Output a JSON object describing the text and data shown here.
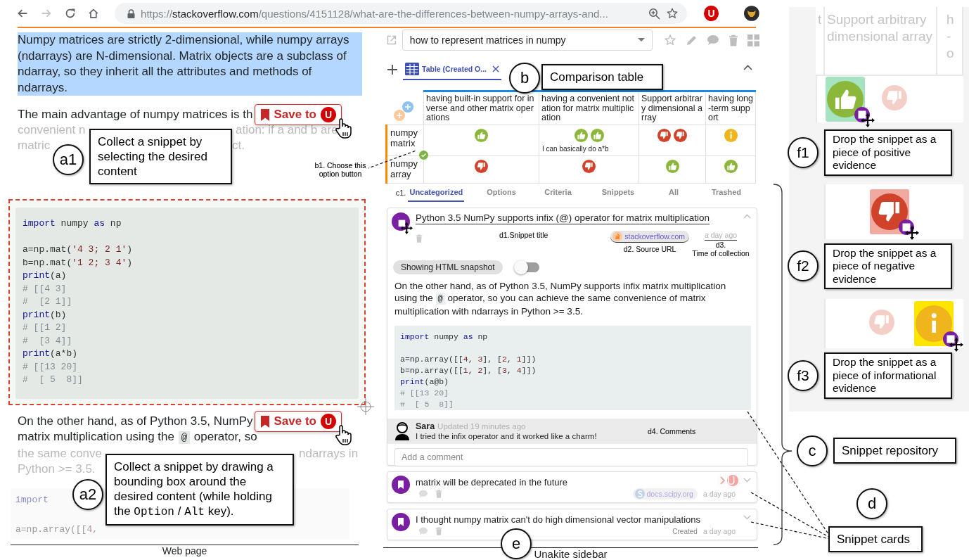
{
  "browser": {
    "url": {
      "scheme": "https://",
      "host": "stackoverflow.com",
      "path": "/questions/4151128/what-are-the-differences-between-numpy-arrays-and..."
    },
    "extension_badge": "U"
  },
  "web_page": {
    "selected_paragraph": "Numpy matrices are strictly 2-dimensional, while numpy arrays (ndarrays) are N-dimensional. Matrix objects are a subclass of ndarray, so they inherit all the attributes and methods of ndarrays.",
    "paragraph_start": "The main advantage of numpy matrices is th",
    "faded_lines": [
      {
        "left": "convenient n",
        "right": "ation: if a and b are"
      },
      {
        "left": "matric",
        "right": "ct."
      }
    ],
    "save_buttons": [
      {
        "label": "Save to",
        "badge": "U"
      },
      {
        "label": "Save to",
        "badge": "U"
      }
    ],
    "code_lines": [
      {
        "tokens": [
          {
            "text": "import",
            "kind": "keyword"
          },
          {
            "text": " numpy ",
            "kind": "plain"
          },
          {
            "text": "as",
            "kind": "keyword"
          },
          {
            "text": " np",
            "kind": "plain"
          }
        ]
      },
      {
        "gap_before": true,
        "tokens": [
          {
            "text": "a=np.mat(",
            "kind": "plain"
          },
          {
            "text": "'4 3; 2 1'",
            "kind": "string"
          },
          {
            "text": ")",
            "kind": "plain"
          }
        ]
      },
      {
        "tokens": [
          {
            "text": "b=np.mat(",
            "kind": "plain"
          },
          {
            "text": "'1 2; 3 4'",
            "kind": "string"
          },
          {
            "text": ")",
            "kind": "plain"
          }
        ]
      },
      {
        "tokens": [
          {
            "text": "print",
            "kind": "keyword"
          },
          {
            "text": "(a)",
            "kind": "plain"
          }
        ]
      },
      {
        "tokens": [
          {
            "text": "# [[4 3]",
            "kind": "comment"
          }
        ]
      },
      {
        "tokens": [
          {
            "text": "#  [2 1]]",
            "kind": "comment"
          }
        ]
      },
      {
        "tokens": [
          {
            "text": "print",
            "kind": "keyword"
          },
          {
            "text": "(b)",
            "kind": "plain"
          }
        ]
      },
      {
        "tokens": [
          {
            "text": "# [[1 2]",
            "kind": "comment"
          }
        ]
      },
      {
        "tokens": [
          {
            "text": "#  [3 4]]",
            "kind": "comment"
          }
        ]
      },
      {
        "tokens": [
          {
            "text": "print",
            "kind": "keyword"
          },
          {
            "text": "(a*b)",
            "kind": "plain"
          }
        ]
      },
      {
        "tokens": [
          {
            "text": "# [[13 20]",
            "kind": "comment"
          }
        ]
      },
      {
        "tokens": [
          {
            "text": "#  [ 5  8]]",
            "kind": "comment"
          }
        ]
      }
    ],
    "answer_line_1": "On the other hand, as of Python 3.5, NumPy",
    "answer_line_2": {
      "before": "matrix multiplication using the ",
      "code": "@",
      "after": " operator, so"
    },
    "faded_answer_lines": [
      {
        "left": "the same conve",
        "right": "ndarrays in"
      },
      {
        "left": "Python >= 3.5."
      }
    ],
    "faded_code_lines": [
      {
        "tokens": [
          {
            "text": "import",
            "kind": "keyword"
          }
        ]
      },
      {
        "gap_before": true,
        "tokens": [
          {
            "text": "a=np.array([[",
            "kind": "plain"
          },
          {
            "text": "4",
            "kind": "number"
          },
          {
            "text": ",",
            "kind": "plain"
          }
        ]
      }
    ]
  },
  "sidebar": {
    "task": "how to represent matrices in numpy",
    "table_tab": {
      "label": "Table (Created O...",
      "selected": true
    },
    "table": {
      "columns": [
        "having built-in support for inverse and other matrix operations",
        "having a convenient notation for matrix multiplication",
        "Support arbitrary dimensional array",
        "having long-term support"
      ],
      "rows": [
        {
          "label": "numpy matrix",
          "selected": true,
          "cells": [
            {
              "evidence": [
                {
                  "kind": "positive"
                }
              ]
            },
            {
              "evidence": [
                {
                  "kind": "positive"
                },
                {
                  "kind": "positive"
                }
              ],
              "note": "I can basically do a*b"
            },
            {
              "evidence": [
                {
                  "kind": "negative"
                },
                {
                  "kind": "negative"
                }
              ]
            },
            {
              "evidence": [
                {
                  "kind": "info"
                }
              ]
            }
          ]
        },
        {
          "label": "numpy array",
          "selected": false,
          "cells": [
            {
              "evidence": [
                {
                  "kind": "negative"
                }
              ]
            },
            {
              "evidence": [
                {
                  "kind": "negative"
                }
              ]
            },
            {
              "evidence": [
                {
                  "kind": "positive"
                }
              ]
            },
            {
              "evidence": [
                {
                  "kind": "positive"
                }
              ]
            }
          ]
        }
      ]
    },
    "tab_annotation": "c1.",
    "tabs": [
      {
        "label": "Uncategorized",
        "selected": true
      },
      {
        "label": "Options",
        "selected": false
      },
      {
        "label": "Criteria",
        "selected": false
      },
      {
        "label": "Snippets",
        "selected": false
      },
      {
        "label": "All",
        "selected": false
      },
      {
        "label": "Trashed",
        "selected": false
      }
    ],
    "snippets": [
      {
        "title": "Python 3.5 NumPy supports infix (@) operator for matrix multiplication",
        "expanded": true,
        "title_note": "d1.Snippet title",
        "source": {
          "kind": "stackoverflow",
          "host": "stackoverflow.com",
          "note": "d2. Source URL"
        },
        "time": "a day ago",
        "time_note": [
          "d3.",
          "Time of collection"
        ],
        "snapshot": {
          "label": "Showing HTML snapshot",
          "on": false
        },
        "body": {
          "before": "On the other hand, as of Python 3.5, NumPy supports infix matrix multiplication using the ",
          "code": "@",
          "after": " operator, so you can achieve the same convenience of matrix multiplication with ndarrays in Python >= 3.5."
        },
        "code_lines": [
          {
            "tokens": [
              {
                "text": "import",
                "kind": "keyword"
              },
              {
                "text": " numpy ",
                "kind": "plain"
              },
              {
                "text": "as",
                "kind": "keyword"
              },
              {
                "text": " np",
                "kind": "plain"
              }
            ]
          },
          {
            "gap_before": true,
            "tokens": [
              {
                "text": "a=np.array([[",
                "kind": "plain"
              },
              {
                "text": "4",
                "kind": "number"
              },
              {
                "text": ", ",
                "kind": "plain"
              },
              {
                "text": "3",
                "kind": "number"
              },
              {
                "text": "], [",
                "kind": "plain"
              },
              {
                "text": "2",
                "kind": "number"
              },
              {
                "text": ", ",
                "kind": "plain"
              },
              {
                "text": "1",
                "kind": "number"
              },
              {
                "text": "]])",
                "kind": "plain"
              }
            ]
          },
          {
            "tokens": [
              {
                "text": "b=np.array([[",
                "kind": "plain"
              },
              {
                "text": "1",
                "kind": "number"
              },
              {
                "text": ", ",
                "kind": "plain"
              },
              {
                "text": "2",
                "kind": "number"
              },
              {
                "text": "], [",
                "kind": "plain"
              },
              {
                "text": "3",
                "kind": "number"
              },
              {
                "text": ", ",
                "kind": "plain"
              },
              {
                "text": "4",
                "kind": "number"
              },
              {
                "text": "]])",
                "kind": "plain"
              }
            ]
          },
          {
            "tokens": [
              {
                "text": "print",
                "kind": "keyword"
              },
              {
                "text": "(a@b)",
                "kind": "plain"
              }
            ]
          },
          {
            "tokens": [
              {
                "text": "# [[13 20]",
                "kind": "comment"
              }
            ]
          },
          {
            "tokens": [
              {
                "text": "#  [ 5  8]]",
                "kind": "comment"
              }
            ]
          }
        ],
        "comments": [
          {
            "author": "Sara",
            "time": "Updated 19 minutes ago",
            "text": "I tried the infix operator and it worked like a charm!"
          }
        ],
        "comments_note": "d4. Comments",
        "comment_placeholder": "Add a comment"
      },
      {
        "title": "matrix will be deprecated in the future",
        "expanded": false,
        "source": {
          "kind": "scipy",
          "host": "docs.scipy.org"
        },
        "time": "a day ago",
        "extension_badge": "U"
      },
      {
        "title": "I thought numpy matrix can't do high dimensional vector manipulations",
        "expanded": false,
        "time_prefix": "Created",
        "time": "a day ago"
      }
    ]
  },
  "drop_panel": {
    "header": {
      "left_edge": "t",
      "title": "Support arbitrary dimensional array",
      "right_edge": [
        "h",
        "-",
        "o"
      ]
    },
    "targets": [
      {
        "marker": "f1",
        "text": "Drop the snippet as a piece of positive evidence",
        "icons": [
          {
            "kind": "positive",
            "highlighted": true
          },
          {
            "kind": "negative",
            "highlighted": false
          }
        ]
      },
      {
        "marker": "f2",
        "text": "Drop the snippet as a piece of negative evidence",
        "icons": [
          {
            "kind": "negative",
            "highlighted": true
          }
        ]
      },
      {
        "marker": "f3",
        "text": "Drop the snippet as a piece of informational evidence",
        "icons": [
          {
            "kind": "negative",
            "highlighted": false
          },
          {
            "kind": "info",
            "highlighted": true
          }
        ]
      }
    ]
  },
  "callouts": [
    {
      "kind": "step",
      "marker": "a1",
      "parts": [
        {
          "text": "Collect a snippet by selecting the desired content",
          "kind": "plain"
        }
      ]
    },
    {
      "kind": "step",
      "marker": "a2",
      "parts": [
        {
          "text": "Collect a snippet by drawing a bounding box around the desired content (while holding the ",
          "kind": "plain"
        },
        {
          "text": "Option",
          "kind": "mono"
        },
        {
          "text": " / ",
          "kind": "plain"
        },
        {
          "text": "Alt",
          "kind": "mono"
        },
        {
          "text": " key).",
          "kind": "plain"
        }
      ]
    },
    {
      "kind": "step",
      "marker": "b",
      "parts": [
        {
          "text": "Comparison table",
          "kind": "plain"
        }
      ]
    },
    {
      "kind": "note",
      "text": "b1. Choose this option button"
    },
    {
      "kind": "marker",
      "marker": "e"
    },
    {
      "kind": "step",
      "marker": "c",
      "parts": [
        {
          "text": "Snippet repository",
          "kind": "plain"
        }
      ]
    },
    {
      "kind": "step",
      "marker": "d",
      "parts": [
        {
          "text": "Snippet cards",
          "kind": "plain"
        }
      ]
    }
  ],
  "captions": [
    "Web page",
    "Unakite sidebar"
  ]
}
